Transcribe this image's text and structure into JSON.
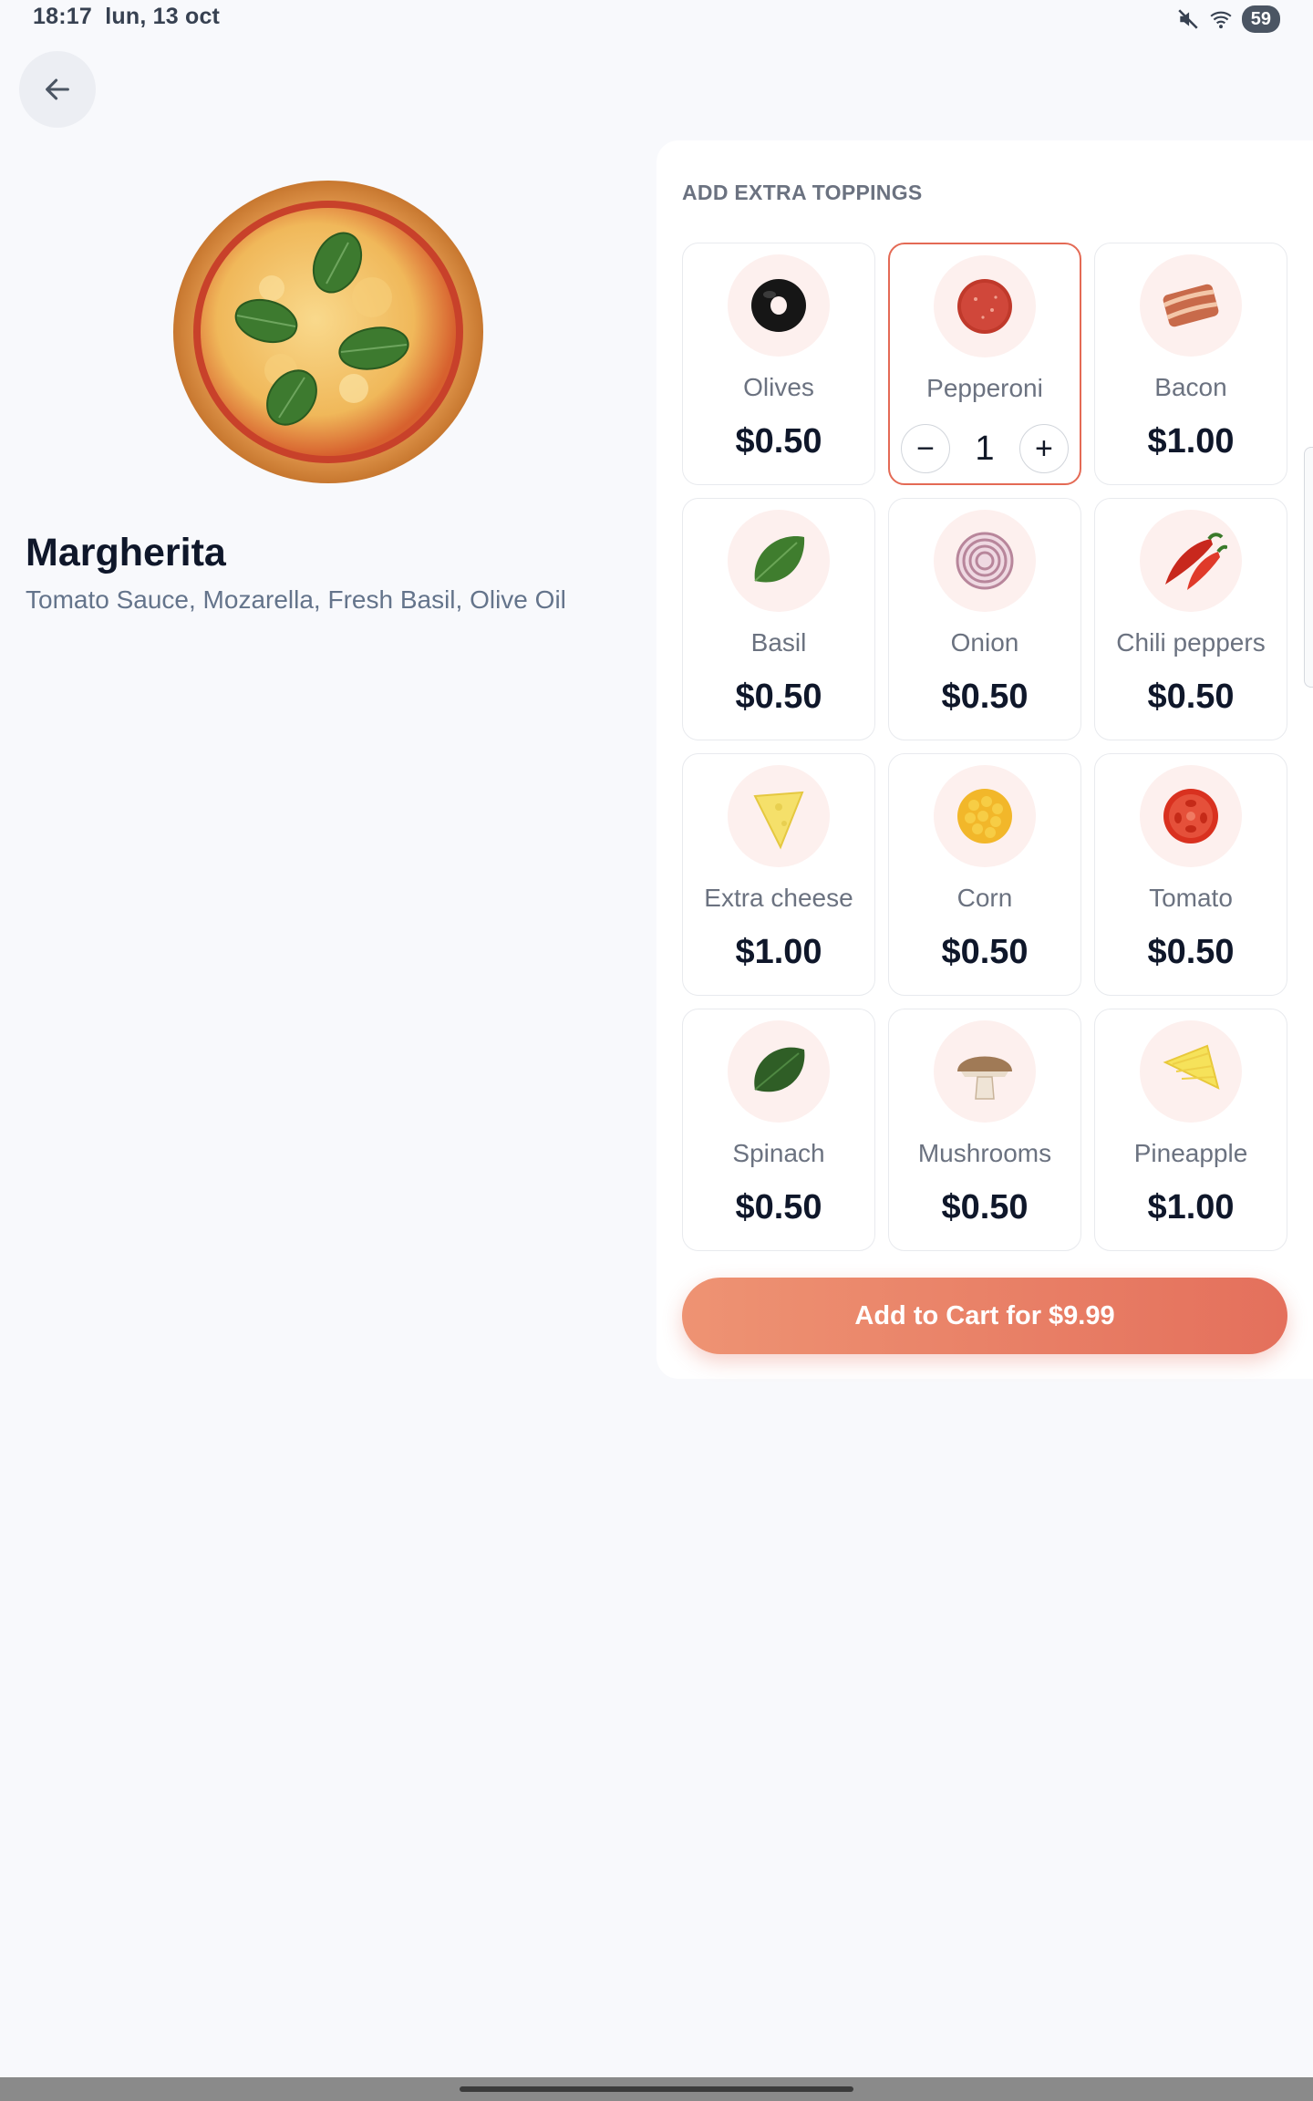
{
  "status": {
    "time": "18:17",
    "date": "lun, 13 oct",
    "battery": "59"
  },
  "product": {
    "name": "Margherita",
    "description": "Tomato Sauce, Mozarella, Fresh Basil, Olive Oil"
  },
  "toppings": {
    "heading": "ADD EXTRA TOPPINGS",
    "items": [
      {
        "name": "Olives",
        "price": "$0.50",
        "icon": "olive-icon"
      },
      {
        "name": "Pepperoni",
        "price": "$0.50",
        "icon": "pepperoni-icon",
        "selected": true,
        "quantity": "1"
      },
      {
        "name": "Bacon",
        "price": "$1.00",
        "icon": "bacon-icon"
      },
      {
        "name": "Basil",
        "price": "$0.50",
        "icon": "basil-icon"
      },
      {
        "name": "Onion",
        "price": "$0.50",
        "icon": "onion-icon"
      },
      {
        "name": "Chili peppers",
        "price": "$0.50",
        "icon": "chili-icon"
      },
      {
        "name": "Extra cheese",
        "price": "$1.00",
        "icon": "cheese-icon"
      },
      {
        "name": "Corn",
        "price": "$0.50",
        "icon": "corn-icon"
      },
      {
        "name": "Tomato",
        "price": "$0.50",
        "icon": "tomato-icon"
      },
      {
        "name": "Spinach",
        "price": "$0.50",
        "icon": "spinach-icon"
      },
      {
        "name": "Mushrooms",
        "price": "$0.50",
        "icon": "mushroom-icon"
      },
      {
        "name": "Pineapple",
        "price": "$1.00",
        "icon": "pineapple-icon"
      }
    ]
  },
  "stepper": {
    "minus": "−",
    "plus": "+"
  },
  "cart": {
    "label": "Add to Cart for $9.99"
  },
  "colors": {
    "accent": "#e46a55",
    "background": "#f8f9fc"
  }
}
